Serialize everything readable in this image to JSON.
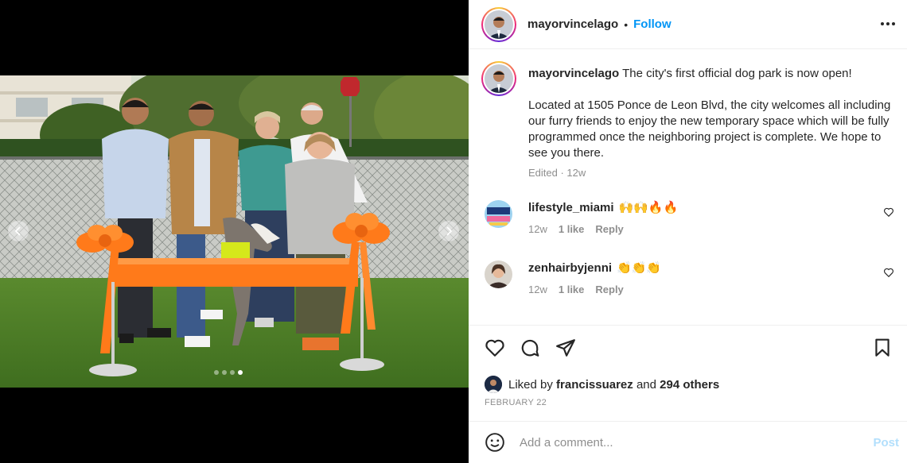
{
  "post": {
    "username": "mayorvincelago",
    "follow_label": "Follow",
    "separator": "•",
    "more_icon": "more-horizontal-icon",
    "caption": {
      "headline": "The city's first official dog park is now open!",
      "body": "Located at 1505 Ponce de Leon Blvd, the city welcomes all including our furry friends to enjoy the new temporary space which will be fully programmed once the neighboring project is complete. We hope to see you there.",
      "edited": "Edited · 12w"
    },
    "comments": [
      {
        "username": "lifestyle_miami",
        "emojis": "🙌🙌🔥🔥",
        "age": "12w",
        "likes": "1 like",
        "reply": "Reply"
      },
      {
        "username": "zenhairbyjenni",
        "emojis": "👏👏👏",
        "age": "12w",
        "likes": "1 like",
        "reply": "Reply"
      }
    ],
    "liked_by": {
      "prefix": "Liked by",
      "user": "francissuarez",
      "and": "and",
      "others": "294 others"
    },
    "date": "FEBRUARY 22",
    "add_comment": {
      "placeholder": "Add a comment...",
      "post_label": "Post"
    },
    "carousel": {
      "count": 4,
      "active": 3
    }
  },
  "colors": {
    "accent": "#0095f6",
    "post_disabled": "#b2dffc",
    "muted": "#8e8e8e",
    "ribbon": "#ff7a1a"
  }
}
